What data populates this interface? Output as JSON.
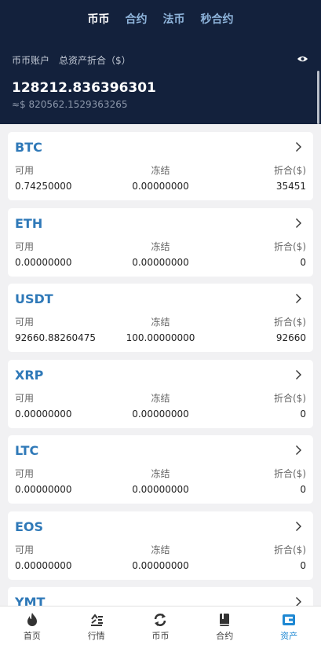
{
  "tabs": [
    "币币",
    "合约",
    "法币",
    "秒合约"
  ],
  "account": {
    "title": "币币账户",
    "total_label": "总资产折合（$）",
    "balance": "128212.836396301",
    "approx": "≈$ 820562.1529363265"
  },
  "column_labels": {
    "available": "可用",
    "frozen": "冻结",
    "converted": "折合($)"
  },
  "assets": [
    {
      "coin": "BTC",
      "available": "0.74250000",
      "frozen": "0.00000000",
      "converted": "35451"
    },
    {
      "coin": "ETH",
      "available": "0.00000000",
      "frozen": "0.00000000",
      "converted": "0"
    },
    {
      "coin": "USDT",
      "available": "92660.88260475",
      "frozen": "100.00000000",
      "converted": "92660"
    },
    {
      "coin": "XRP",
      "available": "0.00000000",
      "frozen": "0.00000000",
      "converted": "0"
    },
    {
      "coin": "LTC",
      "available": "0.00000000",
      "frozen": "0.00000000",
      "converted": "0"
    },
    {
      "coin": "EOS",
      "available": "0.00000000",
      "frozen": "0.00000000",
      "converted": "0"
    },
    {
      "coin": "YMT",
      "available": "",
      "frozen": "",
      "converted": ""
    }
  ],
  "nav": [
    {
      "label": "首页",
      "icon": "fire-icon"
    },
    {
      "label": "行情",
      "icon": "chart-icon"
    },
    {
      "label": "币币",
      "icon": "exchange-icon"
    },
    {
      "label": "合约",
      "icon": "book-icon"
    },
    {
      "label": "资产",
      "icon": "wallet-icon"
    }
  ],
  "colors": {
    "header_bg": "#13213c",
    "coin": "#2f79b8",
    "active_nav": "#1e88d3"
  }
}
